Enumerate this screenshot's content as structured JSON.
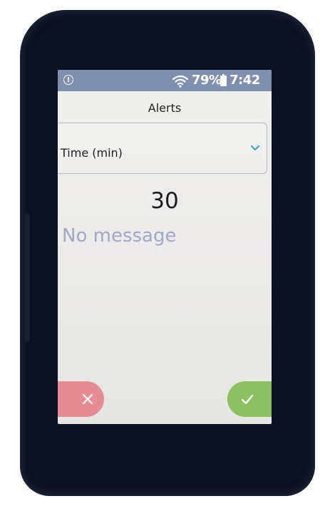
{
  "status_bar": {
    "alert_glyph": "!",
    "icons": [
      "alert-circle-icon",
      "wifi-icon",
      "battery-icon"
    ],
    "battery_percent": "79%",
    "time": "7:42",
    "color": "#7f8fae"
  },
  "screen": {
    "title": "Alerts",
    "dropdown": {
      "selected": "Time (min)",
      "icon": "chevron-down-icon",
      "accent": "#3fa5c9"
    },
    "value": "30",
    "message": "No message"
  },
  "actions": {
    "cancel": {
      "icon": "close-icon",
      "color": "#e58d95"
    },
    "confirm": {
      "icon": "check-icon",
      "color": "#8ebf62"
    }
  }
}
